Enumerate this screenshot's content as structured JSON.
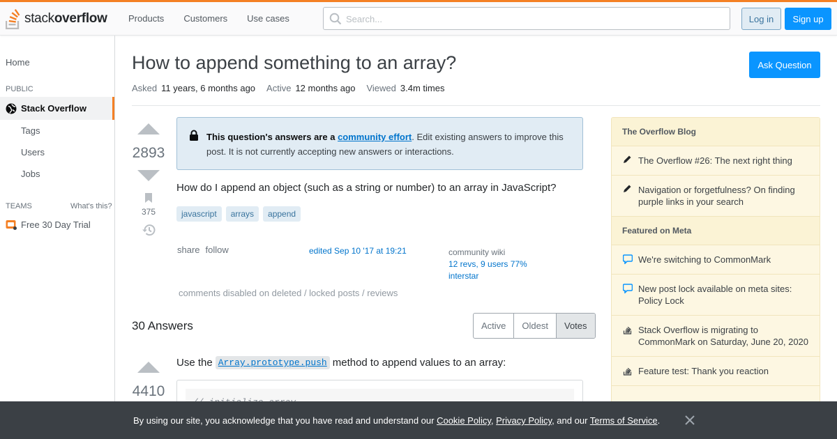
{
  "header": {
    "logo_stack": "stack",
    "logo_overflow": "overflow",
    "nav": [
      "Products",
      "Customers",
      "Use cases"
    ],
    "search_placeholder": "Search...",
    "login": "Log in",
    "signup": "Sign up"
  },
  "leftnav": {
    "home": "Home",
    "public": "PUBLIC",
    "stackoverflow": "Stack Overflow",
    "tags": "Tags",
    "users": "Users",
    "jobs": "Jobs",
    "teams": "TEAMS",
    "whats_this": "What's this?",
    "trial": "Free 30 Day Trial"
  },
  "question": {
    "title": "How to append something to an array?",
    "ask_button": "Ask Question",
    "asked_label": "Asked",
    "asked_value": "11 years, 6 months ago",
    "active_label": "Active",
    "active_value": "12 months ago",
    "viewed_label": "Viewed",
    "viewed_value": "3.4m times",
    "votes": "2893",
    "bookmarks": "375",
    "notice_bold": "This question's answers are a",
    "notice_link": "community effort",
    "notice_rest": ". Edit existing answers to improve this post. It is not currently accepting new answers or interactions.",
    "body": "How do I append an object (such as a string or number) to an array in JavaScript?",
    "tags": [
      "javascript",
      "arrays",
      "append"
    ],
    "share": "share",
    "follow": "follow",
    "edited": "edited Sep 10 '17 at 19:21",
    "cw_label": "community wiki",
    "cw_revs": "12 revs, 9 users 77%",
    "cw_user": "interstar",
    "comments_disabled": "comments disabled on deleted / locked posts / reviews"
  },
  "answers": {
    "heading": "30 Answers",
    "sort": [
      "Active",
      "Oldest",
      "Votes"
    ],
    "first_votes": "4410",
    "first_pre": "Use the",
    "first_code": "Array.prototype.push",
    "first_post": "method to append values to an array:",
    "code_line": "// initialize array"
  },
  "sidebar": {
    "blog_header": "The Overflow Blog",
    "blog_items": [
      "The Overflow #26: The next right thing",
      "Navigation or forgetfulness? On finding purple links in your search"
    ],
    "meta_header": "Featured on Meta",
    "meta_items": [
      "We're switching to CommonMark",
      "New post lock available on meta sites: Policy Lock",
      "Stack Overflow is migrating to CommonMark on Saturday, June 20, 2020",
      "Feature test: Thank you reaction"
    ]
  },
  "cookie": {
    "t1": "By using our site, you acknowledge that you have read and understand our",
    "cookie_policy": "Cookie Policy",
    "sep1": ",",
    "privacy_policy": "Privacy Policy",
    "t2": ", and our",
    "terms": "Terms of Service",
    "t3": "."
  },
  "colors": {
    "accent": "#f48024",
    "primary_blue": "#0a95ff",
    "link_blue": "#0074cc"
  }
}
